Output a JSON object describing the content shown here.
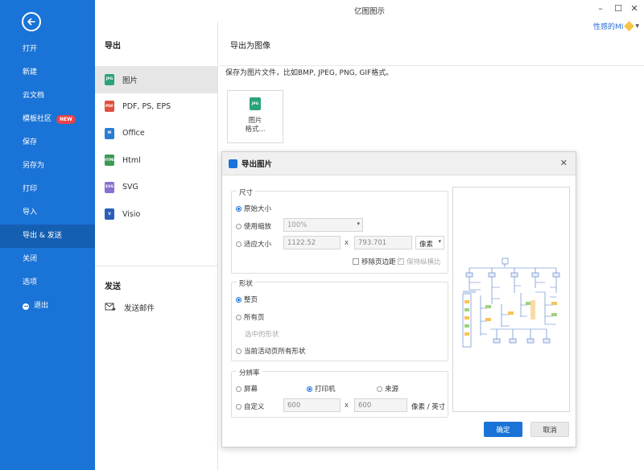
{
  "window": {
    "title": "亿图图示",
    "user": "性感的MI"
  },
  "nav": {
    "items": [
      {
        "label": "打开"
      },
      {
        "label": "新建"
      },
      {
        "label": "云文档"
      },
      {
        "label": "模板社区",
        "badge": "NEW"
      },
      {
        "label": "保存"
      },
      {
        "label": "另存为"
      },
      {
        "label": "打印"
      },
      {
        "label": "导入"
      },
      {
        "label": "导出 & 发送",
        "active": true
      },
      {
        "label": "关闭"
      },
      {
        "label": "选项"
      },
      {
        "label": "退出"
      }
    ]
  },
  "export": {
    "heading": "导出",
    "formats": [
      {
        "label": "图片",
        "icon": "JPG",
        "color": "#2aa37a"
      },
      {
        "label": "PDF, PS, EPS",
        "icon": "PDF",
        "color": "#e0513d"
      },
      {
        "label": "Office",
        "icon": "W",
        "color": "#2b7cd3"
      },
      {
        "label": "Html",
        "icon": "HTML",
        "color": "#3d9a54"
      },
      {
        "label": "SVG",
        "icon": "SVG",
        "color": "#8a6fd1"
      },
      {
        "label": "Visio",
        "icon": "V",
        "color": "#2b5fb7"
      }
    ],
    "send_heading": "发送",
    "send_mail": "发送邮件"
  },
  "content": {
    "heading": "导出为图像",
    "description": "保存为图片文件，比如BMP, JPEG, PNG, GIF格式。",
    "tile_icon": "JPG",
    "tile_label_1": "图片",
    "tile_label_2": "格式..."
  },
  "dialog": {
    "title": "导出图片",
    "size": {
      "legend": "尺寸",
      "original": "原始大小",
      "use_scale": "使用缩放",
      "scale_value": "100%",
      "fit": "适应大小",
      "width": "1122.52",
      "height": "793.701",
      "unit": "像素",
      "remove_margin": "移除页边距",
      "keep_ratio": "保持纵横比"
    },
    "shape": {
      "legend": "形状",
      "whole_page": "整页",
      "all_pages": "所有页",
      "selected": "选中的形状",
      "current_all": "当前活动页所有形状"
    },
    "resolution": {
      "legend": "分辨率",
      "screen": "屏幕",
      "printer": "打印机",
      "source": "来源",
      "custom": "自定义",
      "x_value": "600",
      "y_value": "600",
      "unit": "像素 / 英寸"
    },
    "ok": "确定",
    "cancel": "取消"
  }
}
